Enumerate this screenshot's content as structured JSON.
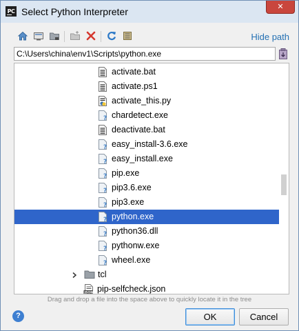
{
  "window": {
    "title": "Select Python Interpreter",
    "app_icon_text": "PC",
    "close_symbol": "✕"
  },
  "toolbar": {
    "icons": [
      "home-icon",
      "desktop-icon",
      "project-folder-icon",
      "new-folder-icon",
      "delete-icon",
      "refresh-icon",
      "show-hidden-icon"
    ],
    "hide_path_label": "Hide path"
  },
  "path": {
    "value": "C:\\Users\\china\\env1\\Scripts\\python.exe"
  },
  "tree": {
    "items": [
      {
        "label": "activate.bat",
        "icon": "text-file-icon",
        "selected": false
      },
      {
        "label": "activate.ps1",
        "icon": "text-file-icon",
        "selected": false
      },
      {
        "label": "activate_this.py",
        "icon": "python-file-icon",
        "selected": false
      },
      {
        "label": "chardetect.exe",
        "icon": "unknown-file-icon",
        "selected": false
      },
      {
        "label": "deactivate.bat",
        "icon": "text-file-icon",
        "selected": false
      },
      {
        "label": "easy_install-3.6.exe",
        "icon": "unknown-file-icon",
        "selected": false
      },
      {
        "label": "easy_install.exe",
        "icon": "unknown-file-icon",
        "selected": false
      },
      {
        "label": "pip.exe",
        "icon": "unknown-file-icon",
        "selected": false
      },
      {
        "label": "pip3.6.exe",
        "icon": "unknown-file-icon",
        "selected": false
      },
      {
        "label": "pip3.exe",
        "icon": "unknown-file-icon",
        "selected": false
      },
      {
        "label": "python.exe",
        "icon": "unknown-file-icon",
        "selected": true
      },
      {
        "label": "python36.dll",
        "icon": "unknown-file-icon",
        "selected": false
      },
      {
        "label": "pythonw.exe",
        "icon": "unknown-file-icon",
        "selected": false
      },
      {
        "label": "wheel.exe",
        "icon": "unknown-file-icon",
        "selected": false
      },
      {
        "label": "tcl",
        "icon": "folder-icon",
        "selected": false
      },
      {
        "label": "pip-selfcheck.json",
        "icon": "json-file-icon",
        "selected": false
      }
    ]
  },
  "hint": "Drag and drop a file into the space above to quickly locate it in the tree",
  "buttons": {
    "help": "?",
    "ok": "OK",
    "cancel": "Cancel"
  },
  "colors": {
    "selection": "#2f65ca",
    "link": "#2470b3",
    "close": "#c9463d",
    "titlebar": "#dbe6f2"
  }
}
